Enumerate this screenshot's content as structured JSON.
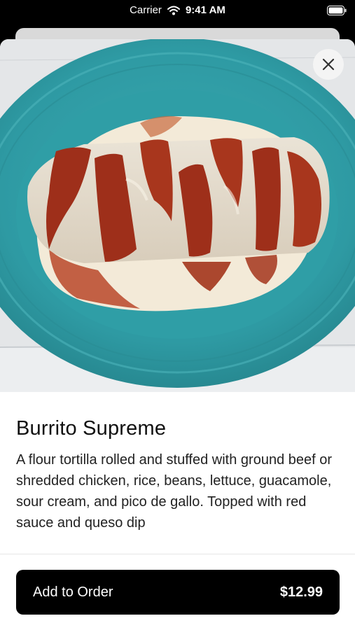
{
  "status_bar": {
    "carrier": "Carrier",
    "time": "9:41 AM"
  },
  "item": {
    "name": "Burrito Supreme",
    "description": "A flour tortilla rolled and stuffed with ground beef or shredded chicken, rice, beans, lettuce, guacamole, sour cream, and pico de gallo. Topped with red sauce and queso dip"
  },
  "order": {
    "button_label": "Add to Order",
    "price": "$12.99"
  },
  "icons": {
    "close": "close-icon",
    "wifi": "wifi-icon",
    "battery": "battery-icon"
  },
  "colors": {
    "plate": "#2e9aa3",
    "sauce": "#9e2f1a",
    "queso": "#f3ead8",
    "button": "#000000"
  }
}
